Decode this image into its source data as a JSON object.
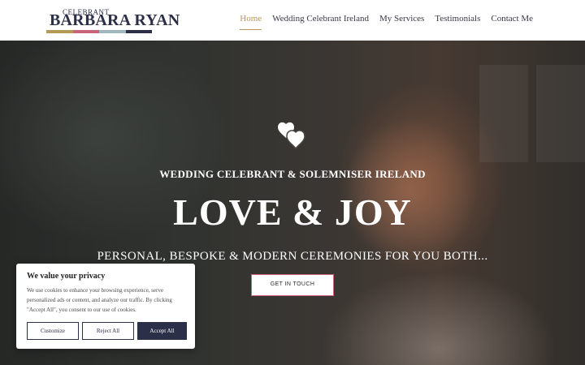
{
  "logo": {
    "top_text": "CELEBRANT",
    "main_text": "BARBARA RYAN",
    "bar_colors": [
      "#b39a55",
      "#c9647a",
      "#9fb8bd",
      "#2c2f48"
    ]
  },
  "nav": {
    "items": [
      {
        "label": "Home",
        "active": true
      },
      {
        "label": "Wedding Celebrant Ireland",
        "active": false
      },
      {
        "label": "My Services",
        "active": false
      },
      {
        "label": "Testimonials",
        "active": false
      },
      {
        "label": "Contact Me",
        "active": false
      }
    ],
    "active_color": "#b8965a"
  },
  "hero": {
    "icon": "hearts-icon",
    "subtitle": "WEDDING CELEBRANT & SOLEMNISER IRELAND",
    "title": "LOVE & JOY",
    "tagline": "PERSONAL, BESPOKE & MODERN CEREMONIES FOR YOU BOTH...",
    "cta_label": "GET IN TOUCH",
    "cta_border_color": "#c9647a"
  },
  "cookie": {
    "title": "We value your privacy",
    "text": "We use cookies to enhance your browsing experience, serve personalized ads or content, and analyze our traffic. By clicking \"Accept All\", you consent to our use of cookies.",
    "customize_label": "Customize",
    "reject_label": "Reject All",
    "accept_label": "Accept All",
    "button_color": "#2c2f48"
  }
}
